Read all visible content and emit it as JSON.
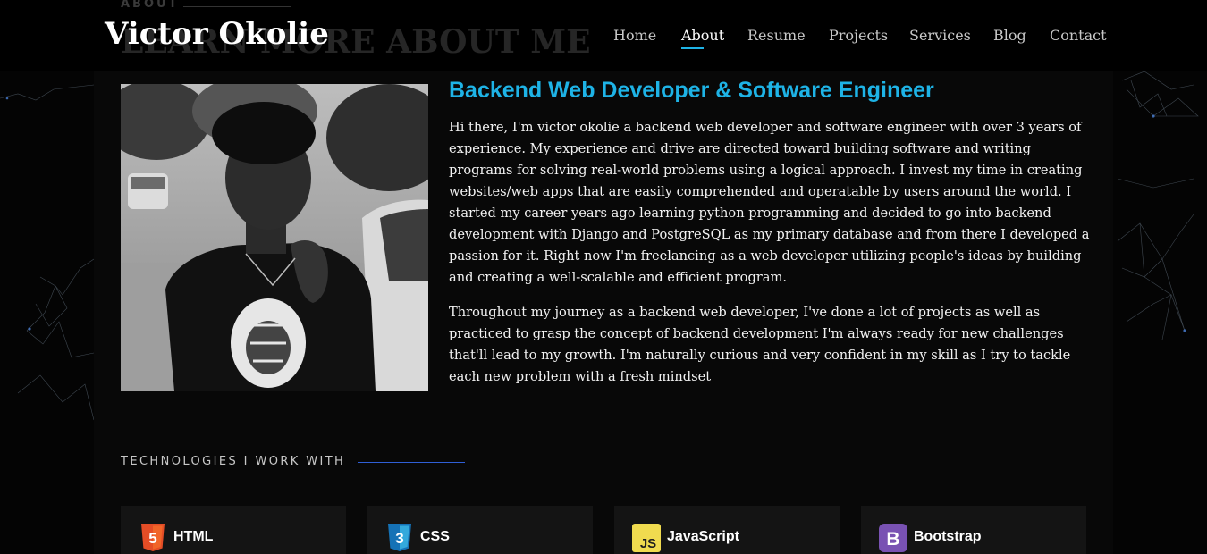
{
  "header": {
    "logo": "Victor Okolie",
    "ghost_label": "ABOUT",
    "ghost_title": "LEARN MORE ABOUT ME",
    "nav": [
      {
        "label": "Home"
      },
      {
        "label": "About",
        "active": true
      },
      {
        "label": "Resume"
      },
      {
        "label": "Projects"
      },
      {
        "label": "Services"
      },
      {
        "label": "Blog"
      },
      {
        "label": "Contact"
      }
    ]
  },
  "about": {
    "role": "Backend Web Developer & Software Engineer",
    "paragraphs": [
      "Hi there, I'm victor okolie a backend web developer and software engineer with over 3 years of experience. My experience and drive are directed toward building software and writing programs for solving real-world problems using a logical approach. I invest my time in creating websites/web apps that are easily comprehended and operatable by users around the world. I started my career years ago learning python programming and decided to go into backend development with Django and PostgreSQL as my primary database and from there I developed a passion for it. Right now I'm freelancing as a web developer utilizing people's ideas by building and creating a well-scalable and efficient program.",
      "Throughout my journey as a backend web developer, I've done a lot of projects as well as practiced to grasp the concept of backend development I'm always ready for new challenges that'll lead to my growth. I'm naturally curious and very confident in my skill as I try to tackle each new problem with a fresh mindset"
    ]
  },
  "technologies": {
    "heading": "TECHNOLOGIES I WORK WITH",
    "items": [
      {
        "name": "HTML",
        "icon": "html5-icon",
        "color": "#e44d26",
        "glyph": "5"
      },
      {
        "name": "CSS",
        "icon": "css3-icon",
        "color": "#1572b6",
        "glyph": "3"
      },
      {
        "name": "JavaScript",
        "icon": "javascript-icon",
        "color": "#f0db4f",
        "glyph": "JS"
      },
      {
        "name": "Bootstrap",
        "icon": "bootstrap-icon",
        "color": "#7952b3",
        "glyph": "B"
      }
    ]
  },
  "colors": {
    "accent": "#1eb3e6",
    "background": "#040404",
    "card": "#141414",
    "line": "#2f5fd6"
  }
}
